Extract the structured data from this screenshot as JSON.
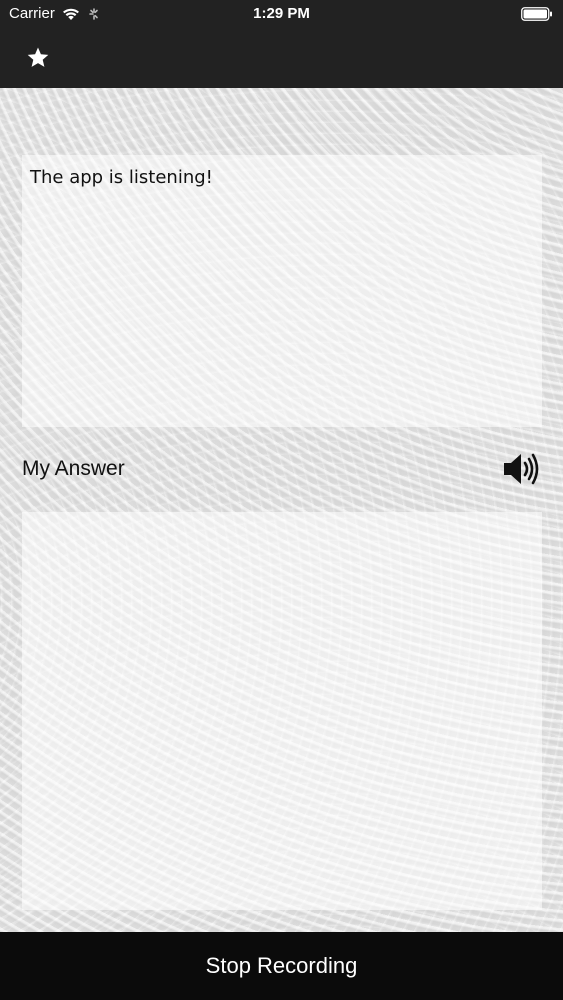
{
  "status_bar": {
    "carrier": "Carrier",
    "time": "1:29 PM"
  },
  "nav": {
    "favorite_icon": "star-icon"
  },
  "question": {
    "text": "The app is listening!"
  },
  "answer": {
    "label": "My Answer",
    "speaker_icon": "speaker-icon",
    "text": ""
  },
  "bottom_bar": {
    "label": "Stop Recording"
  }
}
